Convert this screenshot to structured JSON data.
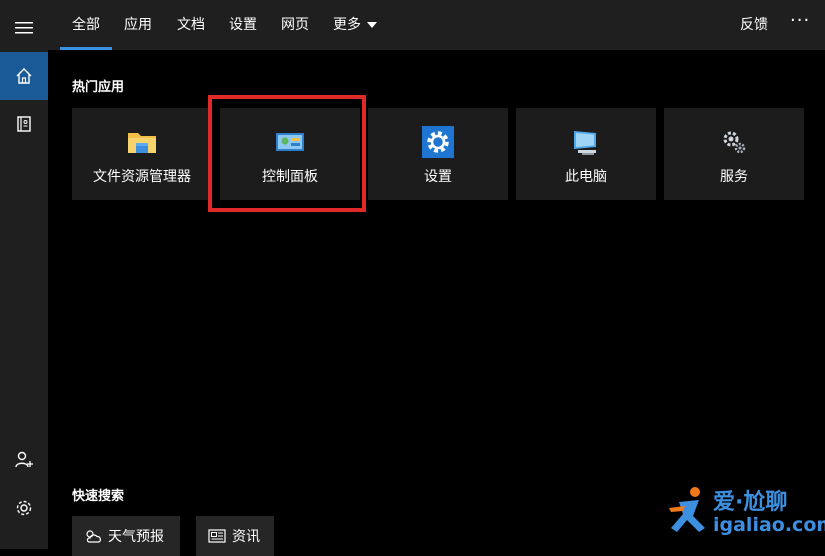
{
  "topbar": {
    "tabs": [
      {
        "label": "全部",
        "active": true
      },
      {
        "label": "应用"
      },
      {
        "label": "文档"
      },
      {
        "label": "设置"
      },
      {
        "label": "网页"
      },
      {
        "label": "更多"
      }
    ],
    "feedback": "反馈",
    "more_options": "···"
  },
  "hot_apps": {
    "title": "热门应用",
    "items": [
      {
        "label": "文件资源管理器",
        "icon": "folder-icon"
      },
      {
        "label": "控制面板",
        "icon": "control-panel-icon"
      },
      {
        "label": "设置",
        "icon": "settings-gear-icon"
      },
      {
        "label": "此电脑",
        "icon": "computer-icon"
      },
      {
        "label": "服务",
        "icon": "services-gears-icon"
      }
    ]
  },
  "quick_search": {
    "title": "快速搜索",
    "items": [
      {
        "label": "天气预报",
        "icon": "weather-icon"
      },
      {
        "label": "资讯",
        "icon": "news-icon"
      }
    ]
  },
  "watermark": {
    "text": "爱·尬聊",
    "url": "igaliao.com"
  },
  "colors": {
    "accent": "#3d8fe0",
    "sidebar_active": "#1a5a96",
    "highlight_box": "#e02a2a"
  }
}
